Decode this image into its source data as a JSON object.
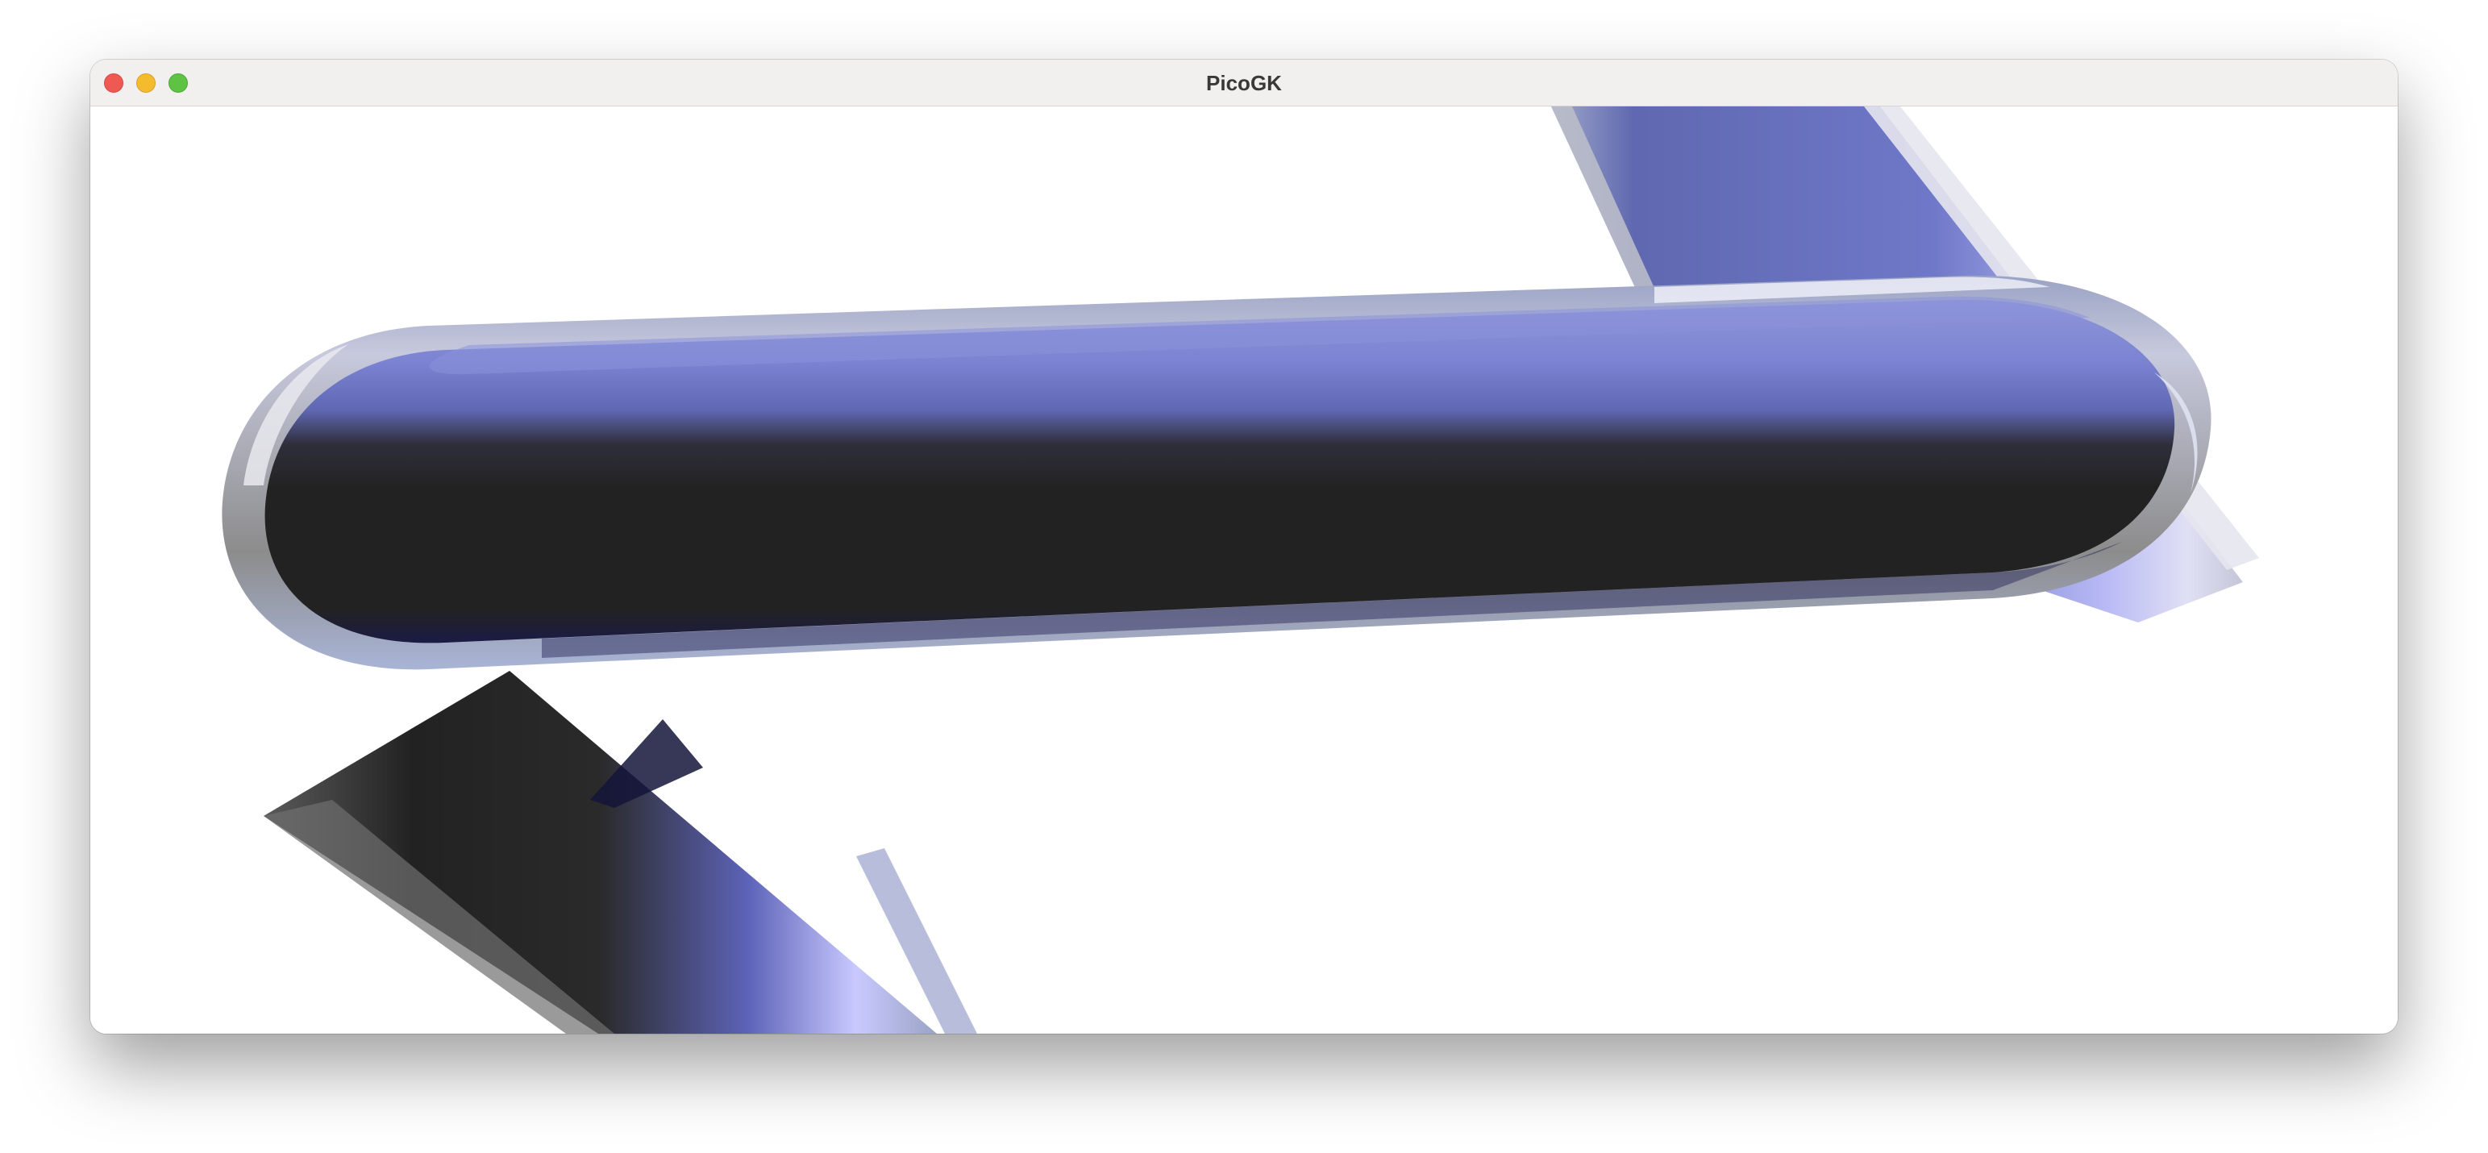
{
  "window": {
    "title": "PicoGK",
    "controls": {
      "close": "close-icon",
      "minimize": "minimize-icon",
      "maximize": "maximize-icon"
    }
  },
  "viewport": {
    "background": "#ffffff",
    "model": {
      "shell_color": "#a9b4d6",
      "core_color": "#6f78c8",
      "shadow_color": "#222222",
      "highlight_color": "#c9c9ff"
    }
  }
}
